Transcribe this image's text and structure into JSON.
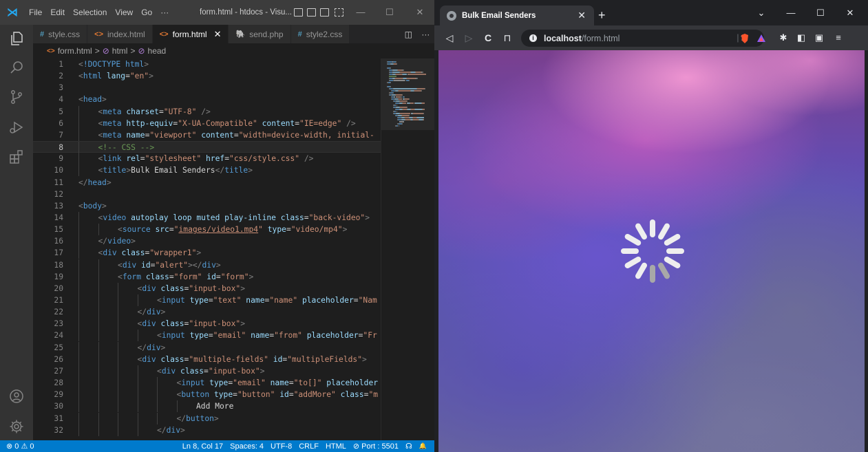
{
  "vscode": {
    "logo_glyph": "⋊",
    "menu": [
      "File",
      "Edit",
      "Selection",
      "View",
      "Go",
      "···"
    ],
    "window_title": "form.html - htdocs - Visu...",
    "window_controls": {
      "minimize": "—",
      "maximize": "☐",
      "close": "✕"
    },
    "tabs": [
      {
        "icon": "#",
        "icon_color": "#519aba",
        "label": "style.css",
        "active": false
      },
      {
        "icon": "<>",
        "icon_color": "#e37933",
        "label": "index.html",
        "active": false
      },
      {
        "icon": "<>",
        "icon_color": "#e37933",
        "label": "form.html",
        "active": true,
        "close": "✕"
      },
      {
        "icon": "🐘",
        "icon_color": "#a074c4",
        "label": "send.php",
        "active": false
      },
      {
        "icon": "#",
        "icon_color": "#519aba",
        "label": "style2.css",
        "active": false
      }
    ],
    "tab_actions": [
      "◫",
      "···"
    ],
    "breadcrumb": {
      "icon": "<>",
      "file": "form.html",
      "sep": ">",
      "item1": "html",
      "item2": "head"
    },
    "current_line": 8,
    "statusbar": {
      "problems": "⊗ 0 ⚠ 0",
      "position": "Ln 8, Col 17",
      "spaces": "Spaces: 4",
      "encoding": "UTF-8",
      "eol": "CRLF",
      "language": "HTML",
      "port": "⊘ Port : 5501",
      "feedback": "☊",
      "bell": "🔔"
    },
    "accent": "#007acc"
  },
  "code_lines": [
    {
      "n": "1",
      "indent": 0,
      "parts": [
        [
          "br",
          "<"
        ],
        [
          "tag",
          "!DOCTYPE"
        ],
        [
          "txt",
          " "
        ],
        [
          "tag",
          "html"
        ],
        [
          "br",
          ">"
        ]
      ]
    },
    {
      "n": "2",
      "indent": 0,
      "parts": [
        [
          "br",
          "<"
        ],
        [
          "tag",
          "html"
        ],
        [
          "txt",
          " "
        ],
        [
          "attr",
          "lang"
        ],
        [
          "txt",
          "="
        ],
        [
          "str",
          "\"en\""
        ],
        [
          "br",
          ">"
        ]
      ]
    },
    {
      "n": "3",
      "indent": 0,
      "parts": []
    },
    {
      "n": "4",
      "indent": 0,
      "parts": [
        [
          "br",
          "<"
        ],
        [
          "tag",
          "head"
        ],
        [
          "br",
          ">"
        ]
      ]
    },
    {
      "n": "5",
      "indent": 1,
      "parts": [
        [
          "br",
          "<"
        ],
        [
          "tag",
          "meta"
        ],
        [
          "txt",
          " "
        ],
        [
          "attr",
          "charset"
        ],
        [
          "txt",
          "="
        ],
        [
          "str",
          "\"UTF-8\""
        ],
        [
          "txt",
          " "
        ],
        [
          "br",
          "/>"
        ]
      ]
    },
    {
      "n": "6",
      "indent": 1,
      "parts": [
        [
          "br",
          "<"
        ],
        [
          "tag",
          "meta"
        ],
        [
          "txt",
          " "
        ],
        [
          "attr",
          "http-equiv"
        ],
        [
          "txt",
          "="
        ],
        [
          "str",
          "\"X-UA-Compatible\""
        ],
        [
          "txt",
          " "
        ],
        [
          "attr",
          "content"
        ],
        [
          "txt",
          "="
        ],
        [
          "str",
          "\"IE=edge\""
        ],
        [
          "txt",
          " "
        ],
        [
          "br",
          "/>"
        ]
      ]
    },
    {
      "n": "7",
      "indent": 1,
      "parts": [
        [
          "br",
          "<"
        ],
        [
          "tag",
          "meta"
        ],
        [
          "txt",
          " "
        ],
        [
          "attr",
          "name"
        ],
        [
          "txt",
          "="
        ],
        [
          "str",
          "\"viewport\""
        ],
        [
          "txt",
          " "
        ],
        [
          "attr",
          "content"
        ],
        [
          "txt",
          "="
        ],
        [
          "str",
          "\"width=device-width, initial-"
        ]
      ]
    },
    {
      "n": "8",
      "indent": 1,
      "parts": [
        [
          "com",
          "<!-- CSS -->"
        ]
      ]
    },
    {
      "n": "9",
      "indent": 1,
      "parts": [
        [
          "br",
          "<"
        ],
        [
          "tag",
          "link"
        ],
        [
          "txt",
          " "
        ],
        [
          "attr",
          "rel"
        ],
        [
          "txt",
          "="
        ],
        [
          "str",
          "\"stylesheet\""
        ],
        [
          "txt",
          " "
        ],
        [
          "attr",
          "href"
        ],
        [
          "txt",
          "="
        ],
        [
          "str",
          "\"css/style.css\""
        ],
        [
          "txt",
          " "
        ],
        [
          "br",
          "/>"
        ]
      ]
    },
    {
      "n": "10",
      "indent": 1,
      "parts": [
        [
          "br",
          "<"
        ],
        [
          "tag",
          "title"
        ],
        [
          "br",
          ">"
        ],
        [
          "txt",
          "Bulk Email Senders"
        ],
        [
          "br",
          "</"
        ],
        [
          "tag",
          "title"
        ],
        [
          "br",
          ">"
        ]
      ]
    },
    {
      "n": "11",
      "indent": 0,
      "parts": [
        [
          "br",
          "</"
        ],
        [
          "tag",
          "head"
        ],
        [
          "br",
          ">"
        ]
      ]
    },
    {
      "n": "12",
      "indent": 0,
      "parts": []
    },
    {
      "n": "13",
      "indent": 0,
      "parts": [
        [
          "br",
          "<"
        ],
        [
          "tag",
          "body"
        ],
        [
          "br",
          ">"
        ]
      ]
    },
    {
      "n": "14",
      "indent": 1,
      "parts": [
        [
          "br",
          "<"
        ],
        [
          "tag",
          "video"
        ],
        [
          "txt",
          " "
        ],
        [
          "attr",
          "autoplay loop muted play-inline class"
        ],
        [
          "txt",
          "="
        ],
        [
          "str",
          "\"back-video\""
        ],
        [
          "br",
          ">"
        ]
      ]
    },
    {
      "n": "15",
      "indent": 2,
      "parts": [
        [
          "br",
          "<"
        ],
        [
          "tag",
          "source"
        ],
        [
          "txt",
          " "
        ],
        [
          "attr",
          "src"
        ],
        [
          "txt",
          "="
        ],
        [
          "str",
          "\""
        ],
        [
          "link",
          "images/video1.mp4"
        ],
        [
          "str",
          "\""
        ],
        [
          "txt",
          " "
        ],
        [
          "attr",
          "type"
        ],
        [
          "txt",
          "="
        ],
        [
          "str",
          "\"video/mp4\""
        ],
        [
          "br",
          ">"
        ]
      ]
    },
    {
      "n": "16",
      "indent": 1,
      "parts": [
        [
          "br",
          "</"
        ],
        [
          "tag",
          "video"
        ],
        [
          "br",
          ">"
        ]
      ]
    },
    {
      "n": "17",
      "indent": 1,
      "parts": [
        [
          "br",
          "<"
        ],
        [
          "tag",
          "div"
        ],
        [
          "txt",
          " "
        ],
        [
          "attr",
          "class"
        ],
        [
          "txt",
          "="
        ],
        [
          "str",
          "\"wrapper1\""
        ],
        [
          "br",
          ">"
        ]
      ]
    },
    {
      "n": "18",
      "indent": 2,
      "parts": [
        [
          "br",
          "<"
        ],
        [
          "tag",
          "div"
        ],
        [
          "txt",
          " "
        ],
        [
          "attr",
          "id"
        ],
        [
          "txt",
          "="
        ],
        [
          "str",
          "\"alert\""
        ],
        [
          "br",
          "></"
        ],
        [
          "tag",
          "div"
        ],
        [
          "br",
          ">"
        ]
      ]
    },
    {
      "n": "19",
      "indent": 2,
      "parts": [
        [
          "br",
          "<"
        ],
        [
          "tag",
          "form"
        ],
        [
          "txt",
          " "
        ],
        [
          "attr",
          "class"
        ],
        [
          "txt",
          "="
        ],
        [
          "str",
          "\"form\""
        ],
        [
          "txt",
          " "
        ],
        [
          "attr",
          "id"
        ],
        [
          "txt",
          "="
        ],
        [
          "str",
          "\"form\""
        ],
        [
          "br",
          ">"
        ]
      ]
    },
    {
      "n": "20",
      "indent": 3,
      "parts": [
        [
          "br",
          "<"
        ],
        [
          "tag",
          "div"
        ],
        [
          "txt",
          " "
        ],
        [
          "attr",
          "class"
        ],
        [
          "txt",
          "="
        ],
        [
          "str",
          "\"input-box\""
        ],
        [
          "br",
          ">"
        ]
      ]
    },
    {
      "n": "21",
      "indent": 4,
      "parts": [
        [
          "br",
          "<"
        ],
        [
          "tag",
          "input"
        ],
        [
          "txt",
          " "
        ],
        [
          "attr",
          "type"
        ],
        [
          "txt",
          "="
        ],
        [
          "str",
          "\"text\""
        ],
        [
          "txt",
          " "
        ],
        [
          "attr",
          "name"
        ],
        [
          "txt",
          "="
        ],
        [
          "str",
          "\"name\""
        ],
        [
          "txt",
          " "
        ],
        [
          "attr",
          "placeholder"
        ],
        [
          "txt",
          "="
        ],
        [
          "str",
          "\"Nam"
        ]
      ]
    },
    {
      "n": "22",
      "indent": 3,
      "parts": [
        [
          "br",
          "</"
        ],
        [
          "tag",
          "div"
        ],
        [
          "br",
          ">"
        ]
      ]
    },
    {
      "n": "23",
      "indent": 3,
      "parts": [
        [
          "br",
          "<"
        ],
        [
          "tag",
          "div"
        ],
        [
          "txt",
          " "
        ],
        [
          "attr",
          "class"
        ],
        [
          "txt",
          "="
        ],
        [
          "str",
          "\"input-box\""
        ],
        [
          "br",
          ">"
        ]
      ]
    },
    {
      "n": "24",
      "indent": 4,
      "parts": [
        [
          "br",
          "<"
        ],
        [
          "tag",
          "input"
        ],
        [
          "txt",
          " "
        ],
        [
          "attr",
          "type"
        ],
        [
          "txt",
          "="
        ],
        [
          "str",
          "\"email\""
        ],
        [
          "txt",
          " "
        ],
        [
          "attr",
          "name"
        ],
        [
          "txt",
          "="
        ],
        [
          "str",
          "\"from\""
        ],
        [
          "txt",
          " "
        ],
        [
          "attr",
          "placeholder"
        ],
        [
          "txt",
          "="
        ],
        [
          "str",
          "\"Fr"
        ]
      ]
    },
    {
      "n": "25",
      "indent": 3,
      "parts": [
        [
          "br",
          "</"
        ],
        [
          "tag",
          "div"
        ],
        [
          "br",
          ">"
        ]
      ]
    },
    {
      "n": "26",
      "indent": 3,
      "parts": [
        [
          "br",
          "<"
        ],
        [
          "tag",
          "div"
        ],
        [
          "txt",
          " "
        ],
        [
          "attr",
          "class"
        ],
        [
          "txt",
          "="
        ],
        [
          "str",
          "\"multiple-fields\""
        ],
        [
          "txt",
          " "
        ],
        [
          "attr",
          "id"
        ],
        [
          "txt",
          "="
        ],
        [
          "str",
          "\"multipleFields\""
        ],
        [
          "br",
          ">"
        ]
      ]
    },
    {
      "n": "27",
      "indent": 4,
      "parts": [
        [
          "br",
          "<"
        ],
        [
          "tag",
          "div"
        ],
        [
          "txt",
          " "
        ],
        [
          "attr",
          "class"
        ],
        [
          "txt",
          "="
        ],
        [
          "str",
          "\"input-box\""
        ],
        [
          "br",
          ">"
        ]
      ]
    },
    {
      "n": "28",
      "indent": 5,
      "parts": [
        [
          "br",
          "<"
        ],
        [
          "tag",
          "input"
        ],
        [
          "txt",
          " "
        ],
        [
          "attr",
          "type"
        ],
        [
          "txt",
          "="
        ],
        [
          "str",
          "\"email\""
        ],
        [
          "txt",
          " "
        ],
        [
          "attr",
          "name"
        ],
        [
          "txt",
          "="
        ],
        [
          "str",
          "\"to[]\""
        ],
        [
          "txt",
          " "
        ],
        [
          "attr",
          "placeholder"
        ]
      ]
    },
    {
      "n": "29",
      "indent": 5,
      "parts": [
        [
          "br",
          "<"
        ],
        [
          "tag",
          "button"
        ],
        [
          "txt",
          " "
        ],
        [
          "attr",
          "type"
        ],
        [
          "txt",
          "="
        ],
        [
          "str",
          "\"button\""
        ],
        [
          "txt",
          " "
        ],
        [
          "attr",
          "id"
        ],
        [
          "txt",
          "="
        ],
        [
          "str",
          "\"addMore\""
        ],
        [
          "txt",
          " "
        ],
        [
          "attr",
          "class"
        ],
        [
          "txt",
          "="
        ],
        [
          "str",
          "\"m"
        ]
      ]
    },
    {
      "n": "30",
      "indent": 6,
      "parts": [
        [
          "txt",
          "Add More"
        ]
      ]
    },
    {
      "n": "31",
      "indent": 5,
      "parts": [
        [
          "br",
          "</"
        ],
        [
          "tag",
          "button"
        ],
        [
          "br",
          ">"
        ]
      ]
    },
    {
      "n": "32",
      "indent": 4,
      "parts": [
        [
          "br",
          "</"
        ],
        [
          "tag",
          "div"
        ],
        [
          "br",
          ">"
        ]
      ]
    }
  ],
  "browser": {
    "tab_title": "Bulk Email Senders",
    "tab_close": "✕",
    "new_tab": "+",
    "window_controls": {
      "tab_search": "⌄",
      "minimize": "—",
      "maximize": "☐",
      "close": "✕"
    },
    "nav": {
      "back": "◁",
      "forward": "▷",
      "reload": "C",
      "bookmark": "⊓"
    },
    "url_host": "localhost",
    "url_path": "/form.html",
    "share_icon": "⇪",
    "toolbar_icons": {
      "extensions": "✱",
      "sidebar": "◧",
      "wallet": "▣",
      "menu": "≡"
    },
    "brand_colors": {
      "brave": "#fb542b",
      "rewards": "#8b5cf6"
    },
    "page_state": "loading"
  }
}
